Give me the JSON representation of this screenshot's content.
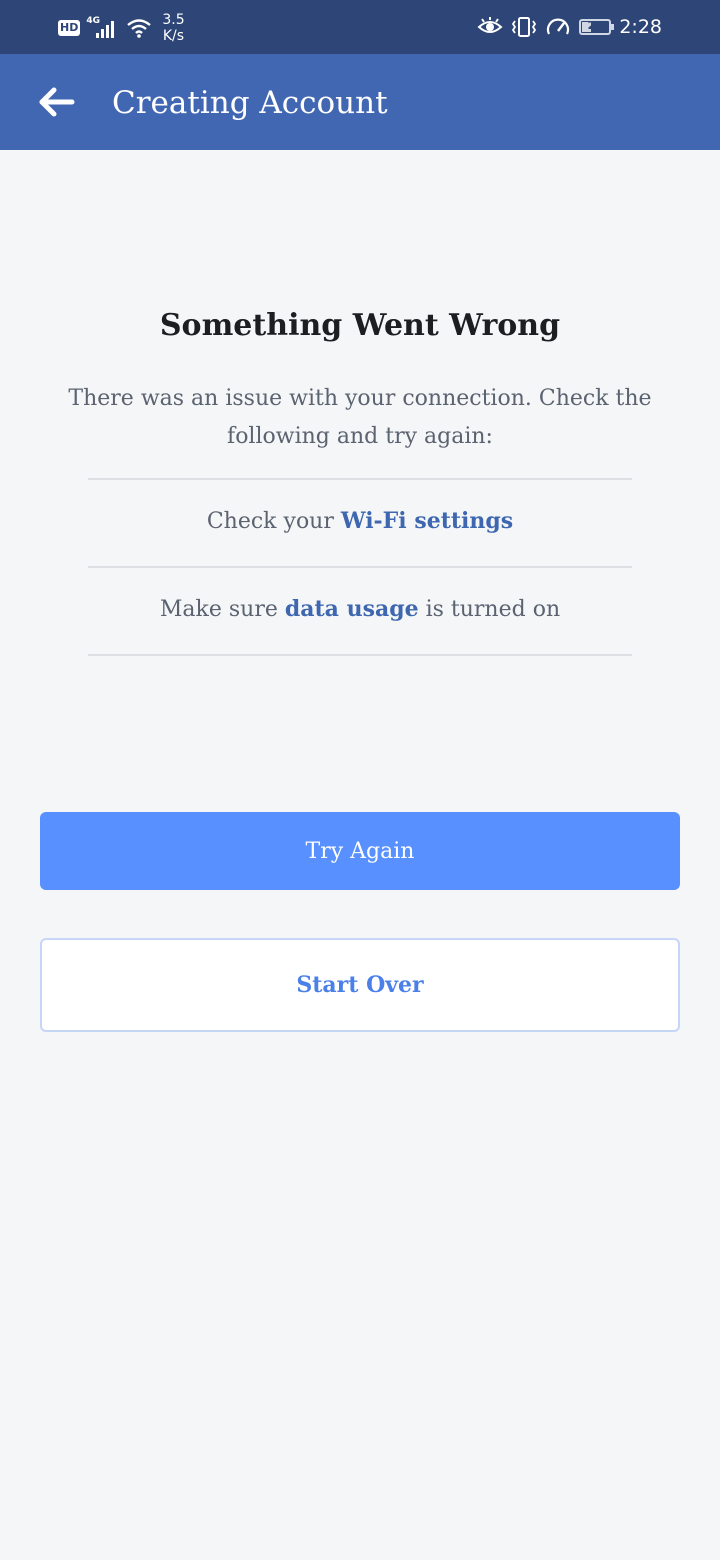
{
  "status_bar": {
    "hd_badge": "HD",
    "network_type": "4G",
    "net_speed_value": "3.5",
    "net_speed_unit": "K/s",
    "battery_level": "27",
    "time": "2:28",
    "icons": [
      "hd-icon",
      "signal-icon",
      "wifi-icon",
      "eye-comfort-icon",
      "vibrate-icon",
      "speed-icon",
      "battery-icon"
    ]
  },
  "header": {
    "back_icon": "back-arrow-icon",
    "title": "Creating Account"
  },
  "error": {
    "title": "Something Went Wrong",
    "description": "There was an issue with your connection. Check the following and try again:"
  },
  "tips": {
    "wifi": {
      "prefix": "Check your ",
      "link": "Wi-Fi settings",
      "suffix": ""
    },
    "data": {
      "prefix": "Make sure ",
      "link": "data usage",
      "suffix": " is turned on"
    }
  },
  "buttons": {
    "try_again": "Try Again",
    "start_over": "Start Over"
  },
  "colors": {
    "status_bar": "#2e4677",
    "header": "#4267b2",
    "primary_button": "#5890ff",
    "link": "#3e67b0",
    "background": "#f5f6f8"
  }
}
